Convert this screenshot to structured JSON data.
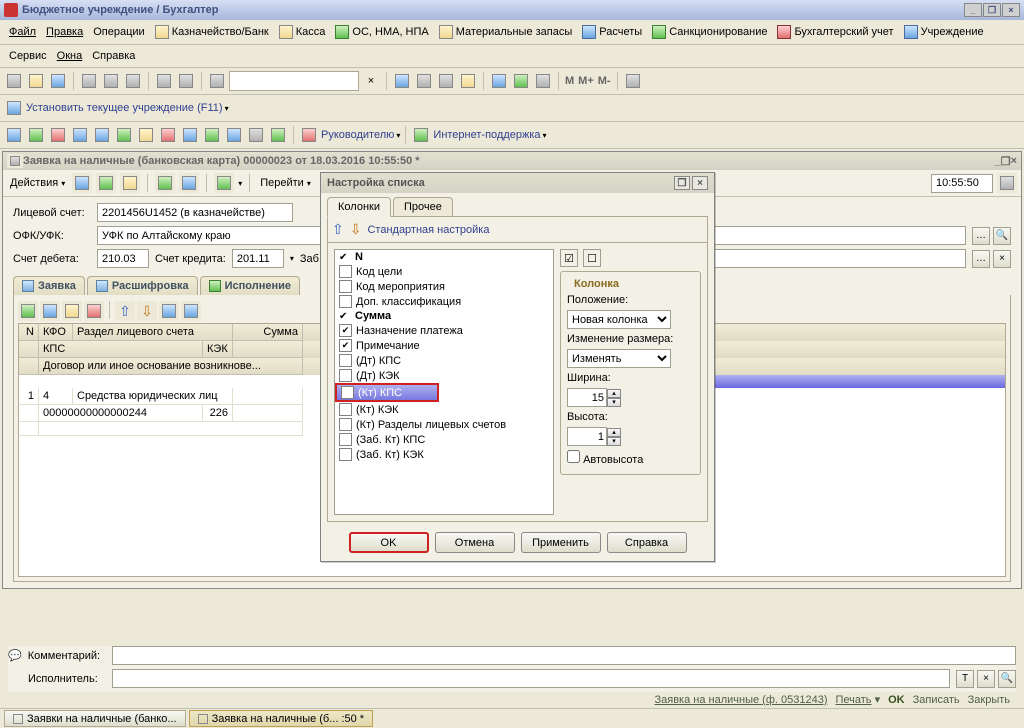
{
  "title": "Бюджетное учреждение / Бухгалтер",
  "menu": {
    "file": "Файл",
    "edit": "Правка",
    "ops": "Операции",
    "treasury": "Казначейство/Банк",
    "cash": "Касса",
    "assets": "ОС, НМА, НПА",
    "stock": "Материальные запасы",
    "calc": "Расчеты",
    "sanc": "Санкционирование",
    "accounting": "Бухгалтерский учет",
    "org": "Учреждение",
    "service": "Сервис",
    "windows": "Окна",
    "help": "Справка"
  },
  "toolbar2": {
    "setorg": "Установить текущее учреждение (F11)"
  },
  "toolbar3": {
    "lead": "Руководителю",
    "support": "Интернет-поддержка"
  },
  "doc": {
    "title": "Заявка на наличные (банковская карта) 00000023 от 18.03.2016 10:55:50 *",
    "actions": "Действия",
    "goto": "Перейти",
    "form": {
      "accountLabel": "Лицевой счет:",
      "account": "2201456U1452 (в казначействе)",
      "ofkLabel": "ОФК/УФК:",
      "ofk": "УФК по Алтайскому краю",
      "dtLabel": "Счет дебета:",
      "dt": "210.03",
      "ktLabel": "Счет кредита:",
      "kt": "201.11",
      "zabLabel": "Заб. сче",
      "timestamp": "10:55:50"
    },
    "tabs": {
      "t1": "Заявка",
      "t2": "Расшифровка",
      "t3": "Исполнение"
    },
    "grid": {
      "h1": "N",
      "h2": "КФО",
      "h3": "Раздел лицевого счета",
      "h4": "Сумма",
      "h5": "КПС",
      "h6": "КЭК",
      "h7": "Договор или иное основание возникнове...",
      "r_n": "1",
      "r_kfo": "4",
      "r_section": "Средства юридических лиц",
      "r_kps": "00000000000000244",
      "r_kek": "226"
    },
    "comment": "Комментарий:",
    "executor": "Исполнитель:"
  },
  "dialog": {
    "title": "Настройка списка",
    "tab1": "Колонки",
    "tab2": "Прочее",
    "std": "Стандартная настройка",
    "items": {
      "n": "N",
      "goal": "Код цели",
      "event": "Код мероприятия",
      "extra": "Доп. классификация",
      "sum": "Сумма",
      "purpose": "Назначение платежа",
      "note": "Примечание",
      "dtkps": "(Дт) КПС",
      "dtkek": "(Дт) КЭК",
      "ktkps": "(Кт) КПС",
      "ktkek": "(Кт) КЭК",
      "ktsections": "(Кт) Разделы лицевых счетов",
      "zabktkps": "(Заб. Кт) КПС",
      "zabktkek": "(Заб. Кт) КЭК"
    },
    "col": {
      "legend": "Колонка",
      "pos": "Положение:",
      "posval": "Новая колонка",
      "resize": "Изменение размера:",
      "resizeval": "Изменять",
      "width": "Ширина:",
      "widthval": "15",
      "height": "Высота:",
      "heightval": "1",
      "auto": "Автовысота"
    },
    "btns": {
      "ok": "OK",
      "cancel": "Отмена",
      "apply": "Применить",
      "help": "Справка"
    }
  },
  "footer": {
    "form": "Заявка на наличные (ф. 0531243)",
    "print": "Печать",
    "ok": "OK",
    "save": "Записать",
    "close": "Закрыть"
  },
  "tasks": {
    "t1": "Заявки на наличные (банко...",
    "t2": "Заявка на наличные (б... :50 *"
  }
}
